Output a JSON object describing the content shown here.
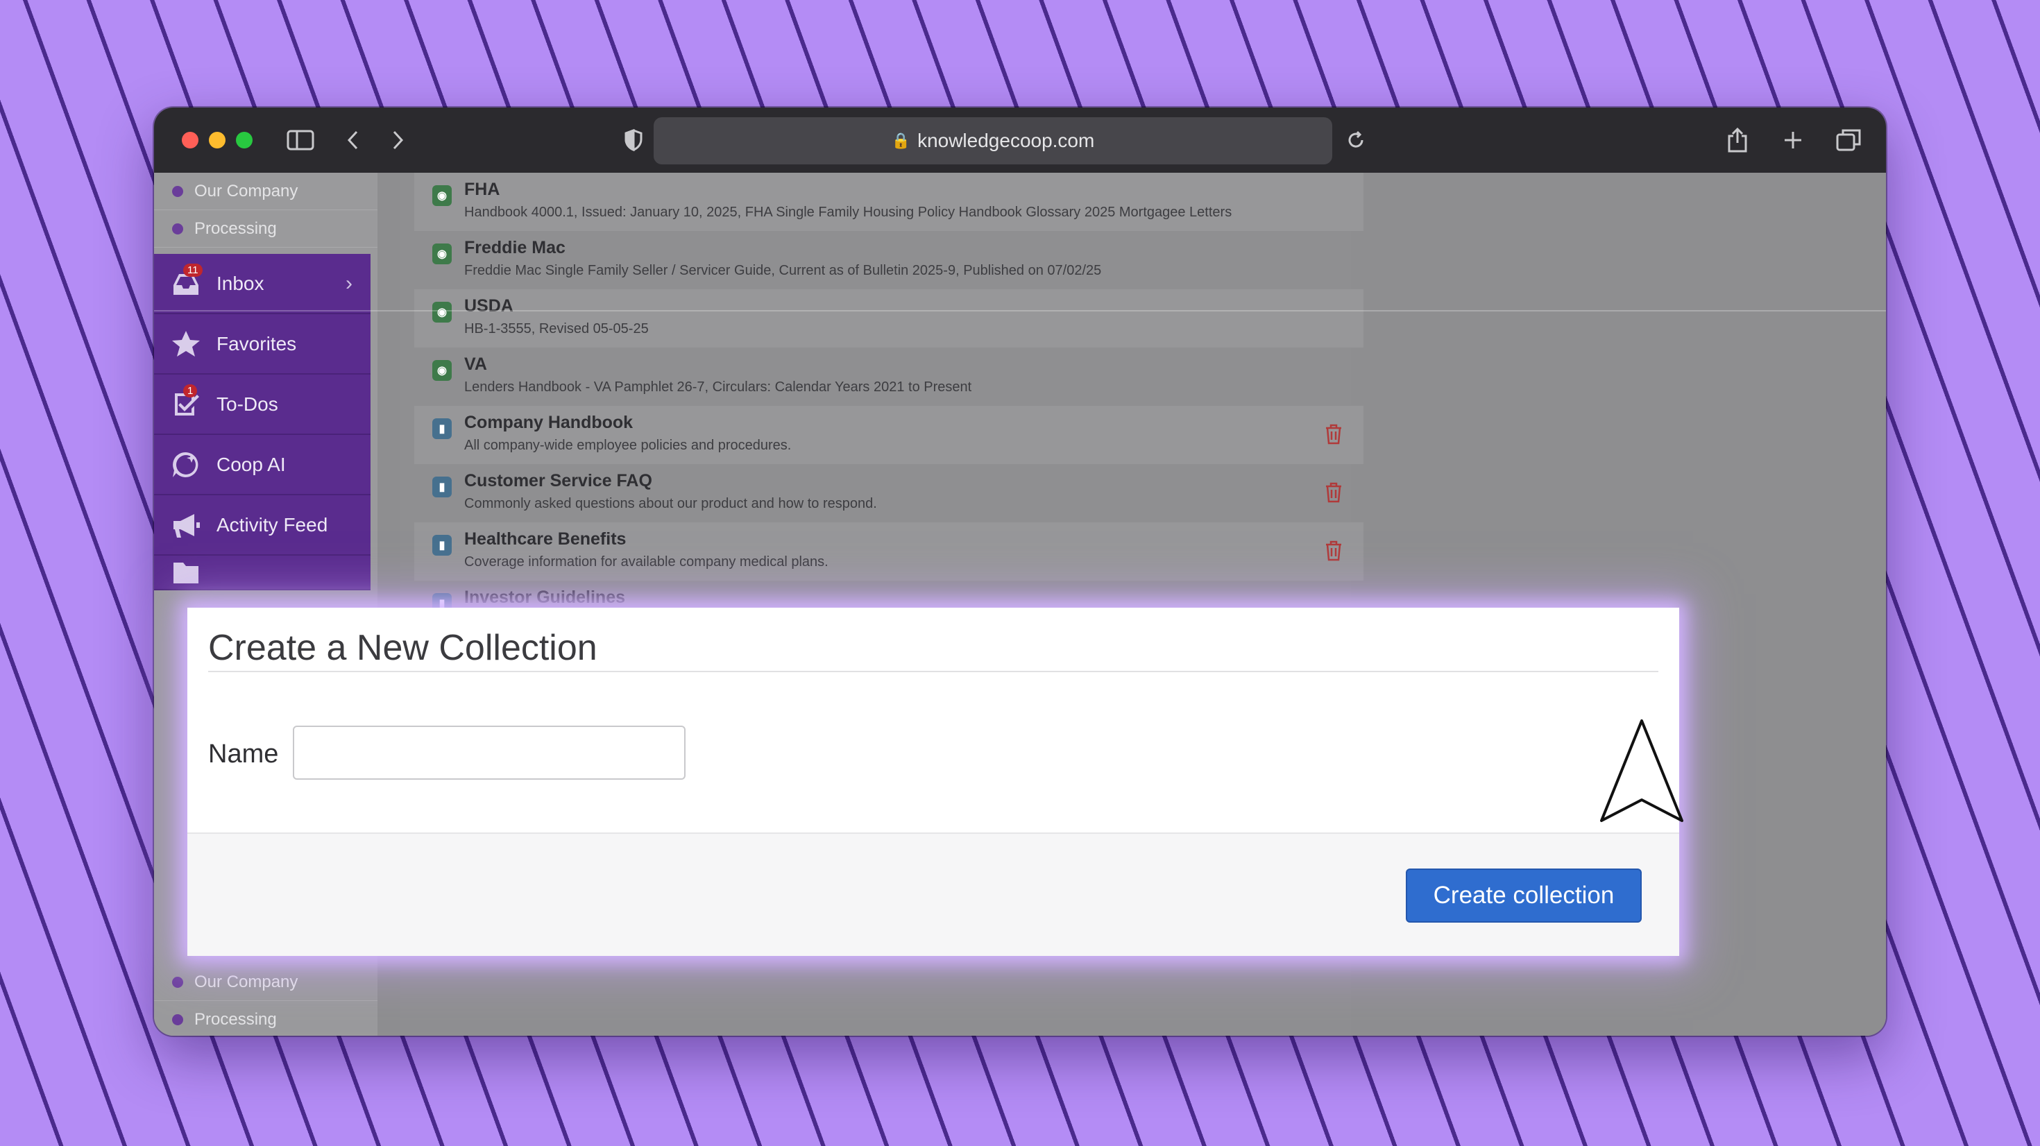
{
  "browser": {
    "url": "knowledgecoop.com"
  },
  "sidebar": {
    "top_items": [
      {
        "label": "Our Company"
      },
      {
        "label": "Processing"
      }
    ],
    "nav": [
      {
        "label": "Inbox",
        "badge": "11",
        "icon": "inbox-icon"
      },
      {
        "label": "Favorites",
        "icon": "star-icon"
      },
      {
        "label": "To-Dos",
        "badge": "1",
        "icon": "checkbox-icon"
      },
      {
        "label": "Coop AI",
        "icon": "chat-ai-icon"
      },
      {
        "label": "Activity Feed",
        "icon": "megaphone-icon"
      }
    ],
    "bottom_items": [
      {
        "label": "Our Company"
      },
      {
        "label": "Processing"
      }
    ]
  },
  "collections": [
    {
      "title": "FHA",
      "desc": "Handbook 4000.1, Issued: January 10, 2025, FHA Single Family Housing Policy Handbook Glossary 2025 Mortgagee Letters",
      "icon": "globe-icon"
    },
    {
      "title": "Freddie Mac",
      "desc": "Freddie Mac Single Family Seller / Servicer Guide, Current as of Bulletin 2025-9, Published on 07/02/25",
      "icon": "globe-icon"
    },
    {
      "title": "USDA",
      "desc": "HB-1-3555, Revised 05-05-25",
      "icon": "globe-icon"
    },
    {
      "title": "VA",
      "desc": "Lenders Handbook - VA Pamphlet 26-7, Circulars: Calendar Years 2021 to Present",
      "icon": "globe-icon"
    },
    {
      "title": "Company Handbook",
      "desc": "All company-wide employee policies and procedures.",
      "icon": "bookmark-icon"
    },
    {
      "title": "Customer Service FAQ",
      "desc": "Commonly asked questions about our product and how to respond.",
      "icon": "bookmark-icon"
    },
    {
      "title": "Healthcare Benefits",
      "desc": "Coverage information for available company medical plans.",
      "icon": "bookmark-icon"
    },
    {
      "title": "Investor Guidelines",
      "desc": "",
      "icon": "bookmark-icon"
    }
  ],
  "modal": {
    "title": "Create a New Collection",
    "name_label": "Name",
    "name_value": "",
    "submit_label": "Create collection"
  },
  "colors": {
    "background": "#b48cf5",
    "nav": "#5a2c8e",
    "button": "#2f6dcf"
  }
}
